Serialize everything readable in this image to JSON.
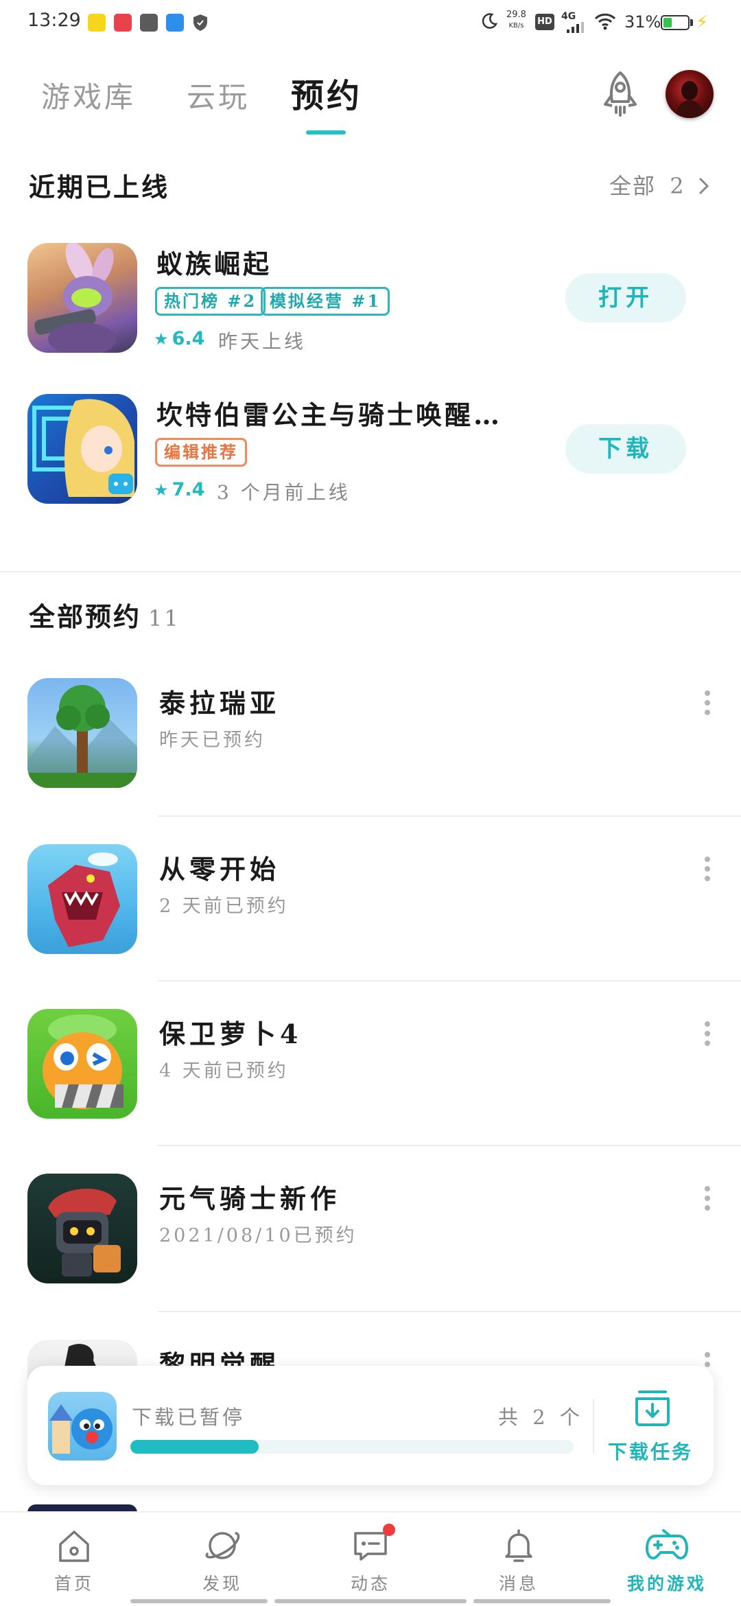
{
  "status_bar": {
    "time": "13:29",
    "net_speed_value": "29.8",
    "net_speed_unit": "KB/s",
    "hd": "HD",
    "signal": "4G",
    "battery": "31%"
  },
  "top_tabs": [
    {
      "label": "游戏库",
      "active": false
    },
    {
      "label": "云玩",
      "active": false
    },
    {
      "label": "预约",
      "active": true
    }
  ],
  "recent_section": {
    "title": "近期已上线",
    "see_all_label": "全部",
    "see_all_count": "2",
    "games": [
      {
        "name": "蚁族崛起",
        "tags": [
          {
            "label": "热门榜 #2",
            "color": "teal"
          },
          {
            "label": "模拟经营 #1",
            "color": "teal"
          }
        ],
        "rating": "6.4",
        "release": "昨天上线",
        "action": "打开"
      },
      {
        "name": "坎特伯雷公主与骑士唤醒…",
        "tags": [
          {
            "label": "编辑推荐",
            "color": "orange"
          }
        ],
        "rating": "7.4",
        "release": "3 个月前上线",
        "action": "下载"
      }
    ]
  },
  "reservations": {
    "title": "全部预约",
    "count": "11",
    "items": [
      {
        "name": "泰拉瑞亚",
        "sub": "昨天已预约"
      },
      {
        "name": "从零开始",
        "sub": "2 天前已预约"
      },
      {
        "name": "保卫萝卜4",
        "sub": "4 天前已预约"
      },
      {
        "name": "元气骑士新作",
        "sub": "2021/08/10已预约"
      },
      {
        "name": "黎明觉醒",
        "sub": ""
      }
    ]
  },
  "download_bar": {
    "status": "下载已暂停",
    "count": "共 2 个",
    "progress": 0.29,
    "task_label": "下载任务"
  },
  "bottom_nav": [
    {
      "label": "首页",
      "icon": "home-icon",
      "active": false
    },
    {
      "label": "发现",
      "icon": "planet-icon",
      "active": false
    },
    {
      "label": "动态",
      "icon": "message-icon",
      "active": false,
      "badge": true
    },
    {
      "label": "消息",
      "icon": "bell-icon",
      "active": false
    },
    {
      "label": "我的游戏",
      "icon": "gamepad-icon",
      "active": true
    }
  ],
  "colors": {
    "accent": "#1fb5ba",
    "tag_orange": "#e9743f",
    "badge_red": "#ee3b3b"
  }
}
